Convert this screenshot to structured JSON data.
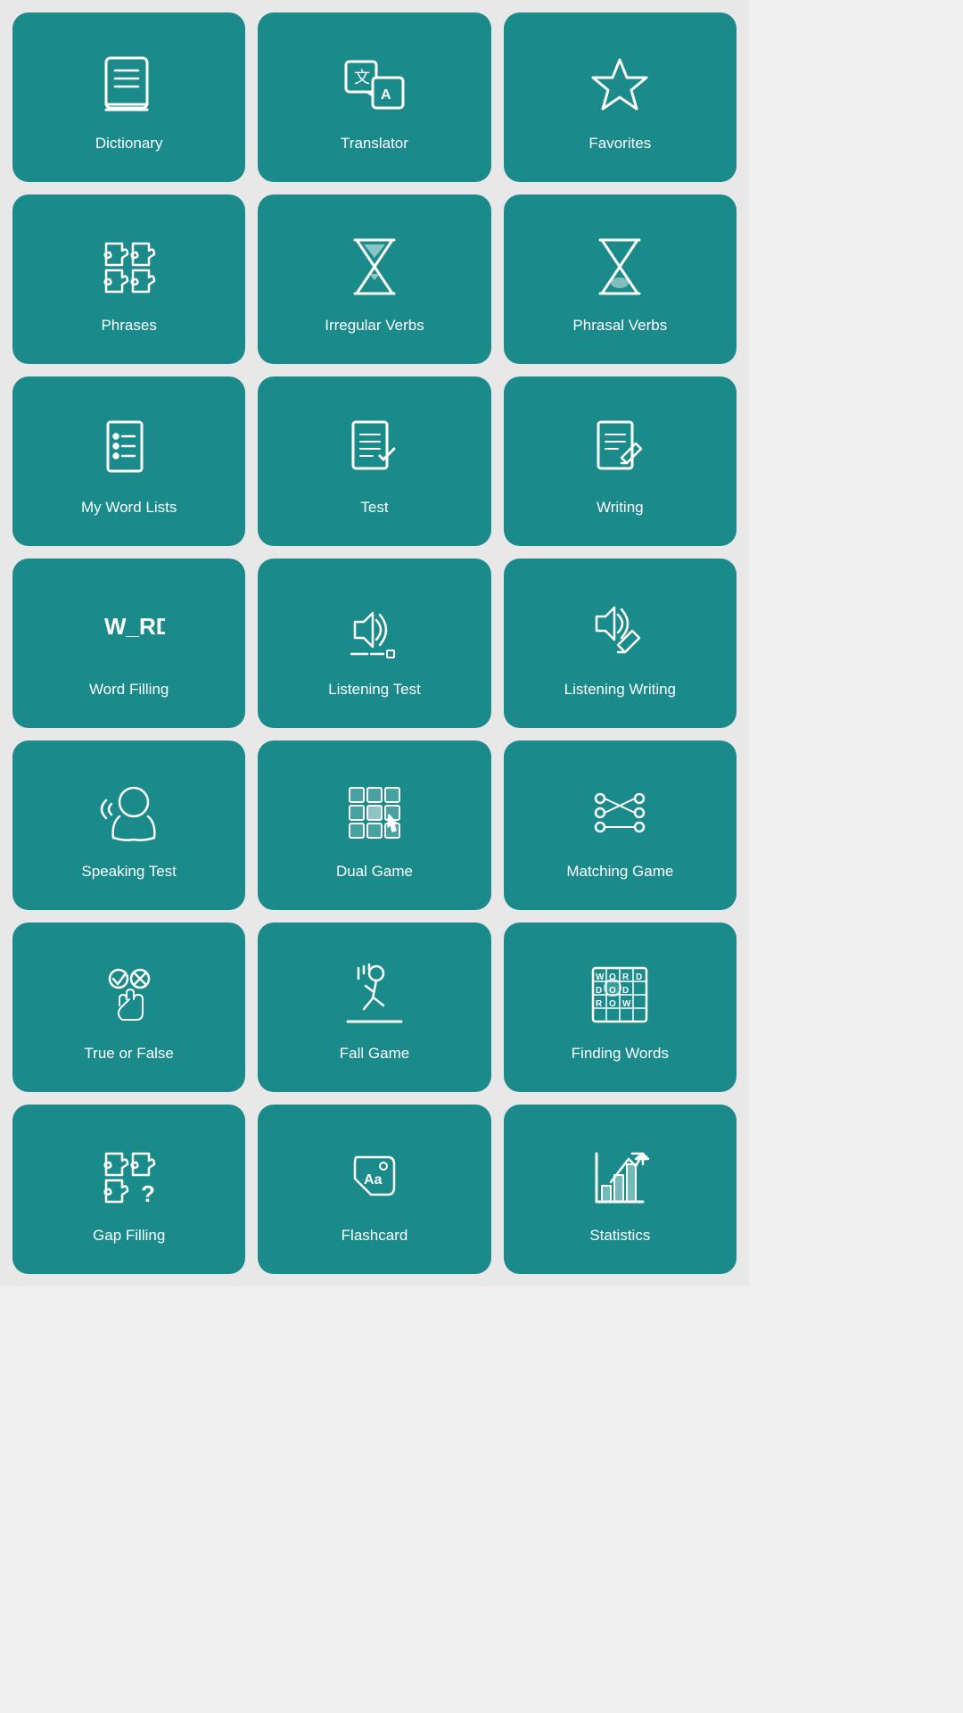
{
  "cards": [
    {
      "id": "dictionary",
      "label": "Dictionary"
    },
    {
      "id": "translator",
      "label": "Translator"
    },
    {
      "id": "favorites",
      "label": "Favorites"
    },
    {
      "id": "phrases",
      "label": "Phrases"
    },
    {
      "id": "irregular-verbs",
      "label": "Irregular Verbs"
    },
    {
      "id": "phrasal-verbs",
      "label": "Phrasal Verbs"
    },
    {
      "id": "my-word-lists",
      "label": "My Word Lists"
    },
    {
      "id": "test",
      "label": "Test"
    },
    {
      "id": "writing",
      "label": "Writing"
    },
    {
      "id": "word-filling",
      "label": "Word Filling"
    },
    {
      "id": "listening-test",
      "label": "Listening Test"
    },
    {
      "id": "listening-writing",
      "label": "Listening Writing"
    },
    {
      "id": "speaking-test",
      "label": "Speaking Test"
    },
    {
      "id": "dual-game",
      "label": "Dual Game"
    },
    {
      "id": "matching-game",
      "label": "Matching Game"
    },
    {
      "id": "true-or-false",
      "label": "True or False"
    },
    {
      "id": "fall-game",
      "label": "Fall Game"
    },
    {
      "id": "finding-words",
      "label": "Finding Words"
    },
    {
      "id": "gap-filling",
      "label": "Gap Filling"
    },
    {
      "id": "flashcard",
      "label": "Flashcard"
    },
    {
      "id": "statistics",
      "label": "Statistics"
    }
  ]
}
